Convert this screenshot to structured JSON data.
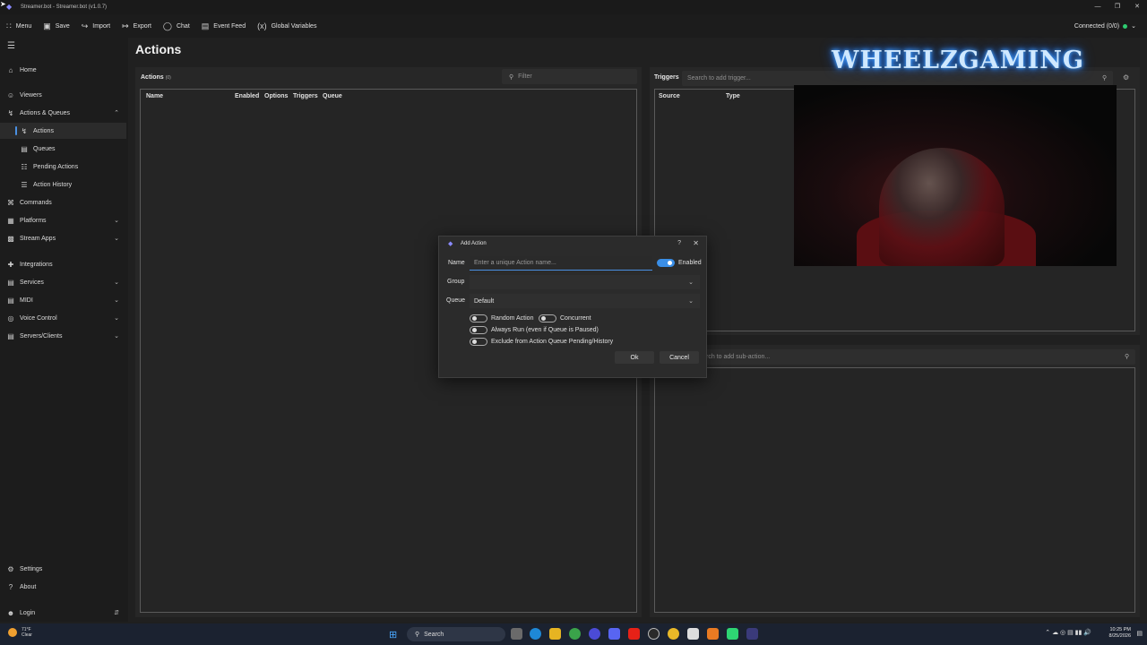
{
  "window": {
    "title": "Streamer.bot - Streamer.bot (v1.0.7)"
  },
  "toolbar": {
    "items": [
      {
        "label": "Menu",
        "icon": "grid-icon"
      },
      {
        "label": "Save",
        "icon": "save-icon"
      },
      {
        "label": "Import",
        "icon": "import-icon"
      },
      {
        "label": "Export",
        "icon": "export-icon"
      },
      {
        "label": "Chat",
        "icon": "chat-icon"
      },
      {
        "label": "Event Feed",
        "icon": "feed-icon"
      },
      {
        "label": "Global Variables",
        "icon": "variables-icon"
      }
    ],
    "connection": "Connected (0/0)",
    "connection_color": "#2ecc71"
  },
  "sidebar": {
    "items": [
      {
        "label": "Home"
      },
      {
        "label": "Viewers"
      },
      {
        "label": "Actions & Queues"
      },
      {
        "label": "Actions"
      },
      {
        "label": "Queues"
      },
      {
        "label": "Pending Actions"
      },
      {
        "label": "Action History"
      },
      {
        "label": "Commands"
      },
      {
        "label": "Platforms"
      },
      {
        "label": "Stream Apps"
      },
      {
        "label": "Integrations"
      },
      {
        "label": "Services"
      },
      {
        "label": "MIDI"
      },
      {
        "label": "Voice Control"
      },
      {
        "label": "Servers/Clients"
      },
      {
        "label": "Settings"
      },
      {
        "label": "About"
      },
      {
        "label": "Login"
      }
    ]
  },
  "page": {
    "title": "Actions"
  },
  "actions_panel": {
    "heading": "Actions",
    "count": "(0)",
    "filter_placeholder": "Filter",
    "columns": [
      "Name",
      "Enabled",
      "Options",
      "Triggers",
      "Queue"
    ]
  },
  "triggers_panel": {
    "heading": "Triggers",
    "search_placeholder": "Search to add trigger...",
    "columns": [
      "Source",
      "Type"
    ]
  },
  "subactions_panel": {
    "search_placeholder": "rch to add sub-action..."
  },
  "overlay": {
    "channel_name": "WHEELZGAMING"
  },
  "dialog": {
    "title": "Add Action",
    "name_label": "Name",
    "name_placeholder": "Enter a unique Action name...",
    "enabled_label": "Enabled",
    "enabled": true,
    "group_label": "Group",
    "group_value": "",
    "queue_label": "Queue",
    "queue_value": "Default",
    "options": [
      {
        "label": "Random Action",
        "on": false
      },
      {
        "label": "Concurrent",
        "on": false
      },
      {
        "label": "Always Run (even if Queue is Paused)",
        "on": false
      },
      {
        "label": "Exclude from Action Queue Pending/History",
        "on": false
      }
    ],
    "ok_label": "Ok",
    "cancel_label": "Cancel"
  },
  "taskbar": {
    "weather_temp": "71°F",
    "weather_desc": "Clear",
    "search_label": "Search",
    "time": "10:25 PM",
    "date": "8/25/2026"
  }
}
